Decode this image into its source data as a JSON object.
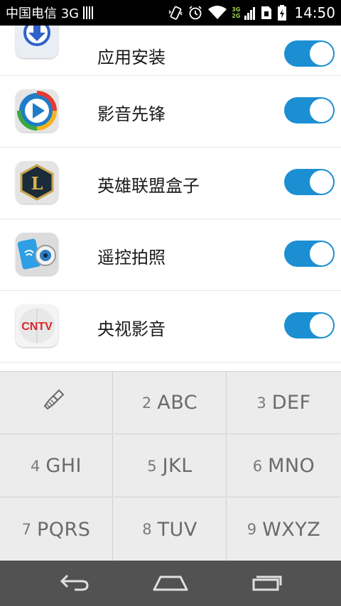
{
  "status_bar": {
    "carrier": "中国电信 3G",
    "net_top": "3G",
    "net_bottom": "2G",
    "time": "14:50"
  },
  "apps": [
    {
      "label": "应用安装",
      "icon": "app-install-icon",
      "enabled": true
    },
    {
      "label": "影音先锋",
      "icon": "video-player-icon",
      "enabled": true
    },
    {
      "label": "英雄联盟盒子",
      "icon": "lol-box-icon",
      "enabled": true
    },
    {
      "label": "遥控拍照",
      "icon": "remote-camera-icon",
      "enabled": true
    },
    {
      "label": "央视影音",
      "icon": "cntv-icon",
      "enabled": true
    }
  ],
  "cntv_logo_text": "CNTV",
  "keypad": {
    "clear_icon": "brush-icon",
    "keys": [
      {
        "digit": "2",
        "letters": "ABC"
      },
      {
        "digit": "3",
        "letters": "DEF"
      },
      {
        "digit": "4",
        "letters": "GHI"
      },
      {
        "digit": "5",
        "letters": "JKL"
      },
      {
        "digit": "6",
        "letters": "MNO"
      },
      {
        "digit": "7",
        "letters": "PQRS"
      },
      {
        "digit": "8",
        "letters": "TUV"
      },
      {
        "digit": "9",
        "letters": "WXYZ"
      }
    ]
  },
  "nav": [
    "back-icon",
    "home-icon",
    "recent-apps-icon"
  ],
  "colors": {
    "toggle_on": "#1b8fd2",
    "keypad_bg": "#ececec",
    "nav_bg": "#525252"
  }
}
